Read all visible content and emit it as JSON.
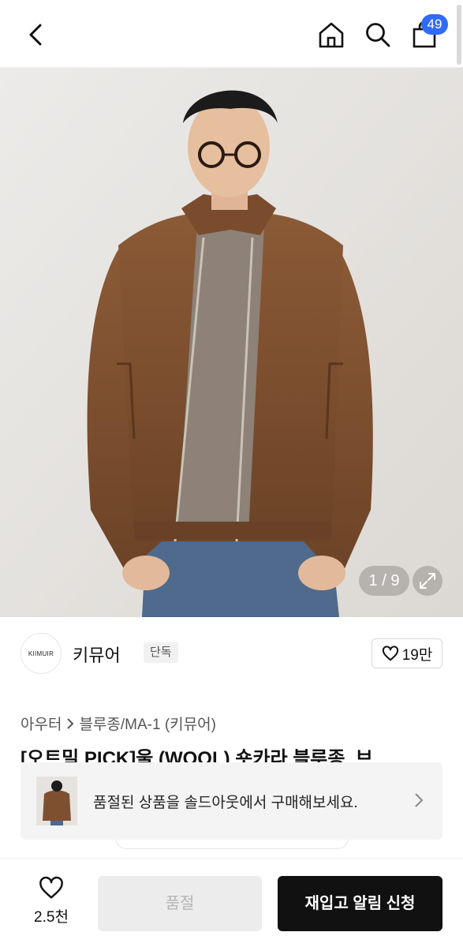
{
  "header": {
    "cart_count": "49"
  },
  "gallery": {
    "counter": "1 / 9"
  },
  "brand": {
    "logo_text": "KIIMUIR",
    "name": "키뮤어",
    "tag": "단독",
    "likes": "19만"
  },
  "product": {
    "breadcrumb": [
      "아우터",
      "블루종/MA-1 (키뮤어)"
    ],
    "title": "[오트밀 PICK]울 (WOOL) 숏카라 블루종_브"
  },
  "banner": {
    "message": "품절된 상품을 솔드아웃에서 구매해보세요."
  },
  "bottom_bar": {
    "heart_count": "2.5천",
    "soldout_label": "품절",
    "restock_label": "재입고 알림 신청"
  }
}
